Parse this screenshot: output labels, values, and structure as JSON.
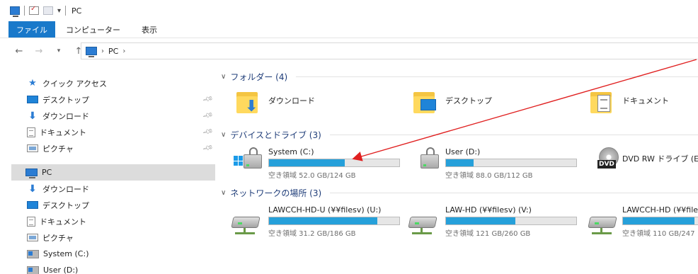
{
  "window": {
    "title": "PC"
  },
  "ribbon": {
    "file_tab": "ファイル",
    "tabs": [
      "コンピューター",
      "表示"
    ]
  },
  "address": {
    "crumb": "PC"
  },
  "nav": {
    "quick_access": "クイック アクセス",
    "quick_items": [
      "デスクトップ",
      "ダウンロード",
      "ドキュメント",
      "ピクチャ"
    ],
    "pc": "PC",
    "pc_items": [
      "ダウンロード",
      "デスクトップ",
      "ドキュメント",
      "ピクチャ",
      "System (C:)",
      "User (D:)"
    ]
  },
  "groups": {
    "folders": "フォルダー (4)",
    "devices": "デバイスとドライブ (3)",
    "network": "ネットワークの場所 (3)"
  },
  "folders": [
    {
      "name": "ダウンロード",
      "icon": "download-folder-icon"
    },
    {
      "name": "デスクトップ",
      "icon": "desktop-folder-icon"
    },
    {
      "name": "ドキュメント",
      "icon": "documents-folder-icon"
    }
  ],
  "drives": [
    {
      "name": "System (C:)",
      "free": "空き領域 52.0 GB/124 GB",
      "used_fraction": 0.58,
      "icon": "windows-drive-icon"
    },
    {
      "name": "User (D:)",
      "free": "空き領域 88.0 GB/112 GB",
      "used_fraction": 0.21,
      "icon": "locked-drive-icon"
    },
    {
      "name": "DVD RW ドライブ (E:)",
      "icon": "dvd-drive-icon"
    }
  ],
  "network_drives": [
    {
      "name": "LAWCCH-HD-U (¥¥filesv) (U:)",
      "free": "空き領域 31.2 GB/186 GB",
      "used_fraction": 0.83
    },
    {
      "name": "LAW-HD (¥¥filesv) (V:)",
      "free": "空き領域 121 GB/260 GB",
      "used_fraction": 0.53
    },
    {
      "name": "LAWCCH-HD (¥¥filesv",
      "free": "空き領域 110 GB/247",
      "used_fraction": 0.55
    }
  ],
  "colors": {
    "accent": "#1979ca",
    "bar_fill": "#26a0da",
    "annotation": "#e02020"
  }
}
